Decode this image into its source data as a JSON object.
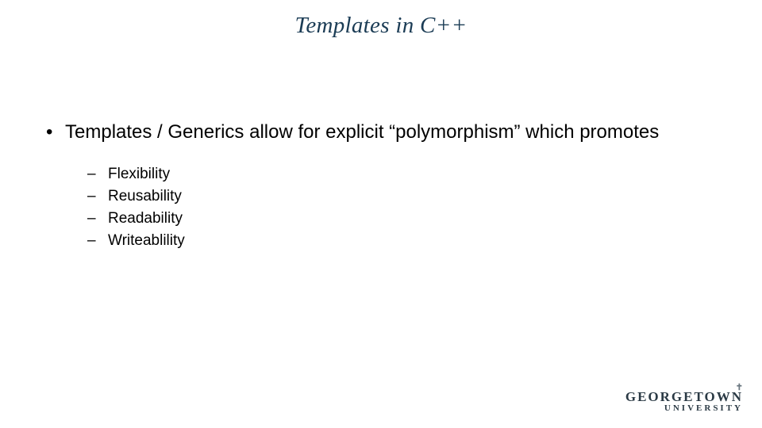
{
  "title": "Templates in C++",
  "bullet": {
    "marker": "•",
    "text": "Templates / Generics allow for explicit “polymorphism” which promotes"
  },
  "subitems": [
    {
      "marker": "–",
      "text": "Flexibility"
    },
    {
      "marker": "–",
      "text": "Reusability"
    },
    {
      "marker": "–",
      "text": "Readability"
    },
    {
      "marker": "–",
      "text": "Writeablility"
    }
  ],
  "logo": {
    "line1": "GEORGETOWN",
    "line2": "UNIVERSITY",
    "cross": "✝"
  }
}
